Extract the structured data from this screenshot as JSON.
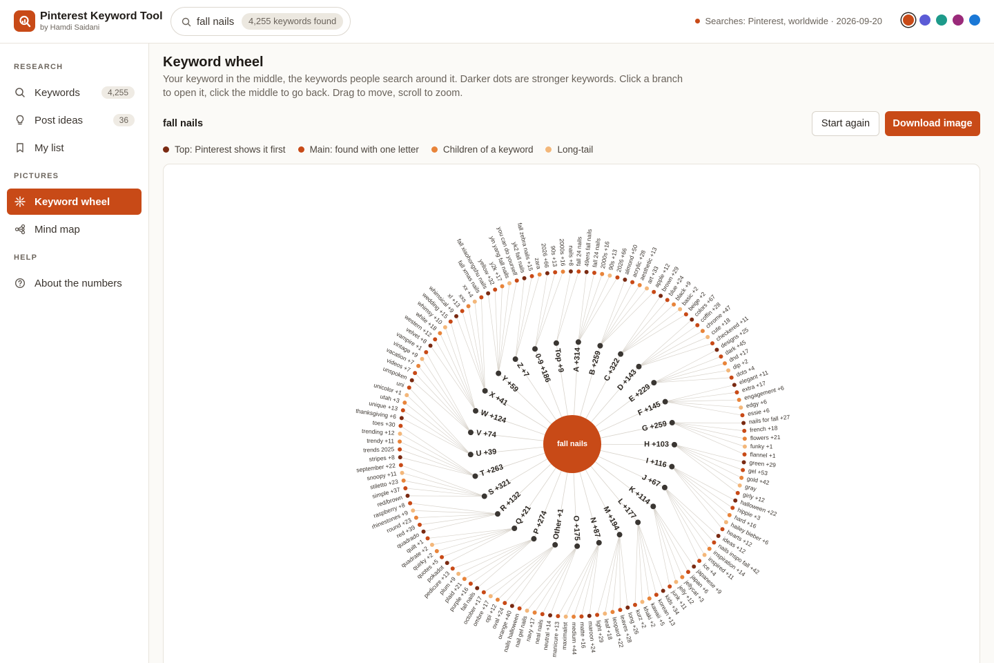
{
  "app": {
    "title": "Pinterest Keyword Tool",
    "byline": "by Hamdi Saidani",
    "brand_color": "#c84a17"
  },
  "search": {
    "query": "fall nails",
    "count_label": "4,255 keywords found",
    "icon": "search-icon"
  },
  "status": {
    "text": "Searches: Pinterest, worldwide · 2026-09-20"
  },
  "theme_swatches": [
    "#c84a17",
    "#5b5bd6",
    "#1d9a8a",
    "#9a2a7a",
    "#1a78d6"
  ],
  "sidebar": {
    "sections": [
      {
        "label": "RESEARCH",
        "items": [
          {
            "label": "Keywords",
            "badge": "4,255",
            "icon": "search-icon"
          },
          {
            "label": "Post ideas",
            "badge": "36",
            "icon": "lightbulb-icon"
          },
          {
            "label": "My list",
            "badge": "",
            "icon": "bookmark-icon"
          }
        ]
      },
      {
        "label": "PICTURES",
        "items": [
          {
            "label": "Keyword wheel",
            "badge": "",
            "icon": "sparkle-icon",
            "active": true
          },
          {
            "label": "Mind map",
            "badge": "",
            "icon": "mindmap-icon"
          }
        ]
      },
      {
        "label": "HELP",
        "items": [
          {
            "label": "About the numbers",
            "badge": "",
            "icon": "help-circle-icon"
          }
        ]
      }
    ]
  },
  "main": {
    "title": "Keyword wheel",
    "description": "Your keyword in the middle, the keywords people search around it. Darker dots are stronger keywords. Click a branch to open it, click the middle to go back. Drag to move, scroll to zoom.",
    "keyword_label": "fall nails",
    "start_again_label": "Start again",
    "download_label": "Download image",
    "legend": [
      {
        "label": "Top: Pinterest shows it first",
        "color": "#7a2a12"
      },
      {
        "label": "Main: found with one letter",
        "color": "#c84a17"
      },
      {
        "label": "Children of a keyword",
        "color": "#e8843a"
      },
      {
        "label": "Long-tail",
        "color": "#f3b77a"
      }
    ]
  },
  "wheel": {
    "center_label": "fall nails",
    "branches": [
      {
        "label": "A +314",
        "leaves": [
          "49ers fall nails",
          "fall 24 nails",
          "2000s +16",
          "90s +13",
          "2026 +66"
        ]
      },
      {
        "label": "B +259",
        "leaves": [
          "almond +50",
          "acrylic +28",
          "aesthetic +13",
          "art +33",
          "apple +12"
        ]
      },
      {
        "label": "C +322",
        "leaves": [
          "brown +29",
          "blue +24",
          "black +9",
          "basic +2",
          "beige +2"
        ]
      },
      {
        "label": "D +143",
        "leaves": [
          "colors +67",
          "coffin +28",
          "chrome +47",
          "cute +18",
          "checkered +11"
        ]
      },
      {
        "label": "E +229",
        "leaves": [
          "designs +25",
          "dark +45",
          "dnd +17",
          "dip +2",
          "dots +4"
        ]
      },
      {
        "label": "F +145",
        "leaves": [
          "elegant +11",
          "extra +17",
          "engagement +6",
          "edgy +6",
          "essie +6"
        ]
      },
      {
        "label": "G +259",
        "leaves": [
          "nails for fall +27",
          "french +18",
          "flowers +21",
          "funky +1",
          "flannel +1"
        ]
      },
      {
        "label": "H +103",
        "leaves": [
          "green +29",
          "gel +53",
          "gold +42",
          "gray",
          "girly +12"
        ]
      },
      {
        "label": "I +116",
        "leaves": [
          "halloween +22",
          "hippie +3",
          "hard +16",
          "hailey bieber +6",
          "hearts +12"
        ]
      },
      {
        "label": "J +67",
        "leaves": [
          "ideas +12",
          "nails inspo fall +42",
          "inspiration +14",
          "inspired +11",
          "ice +4"
        ]
      },
      {
        "label": "K +114",
        "leaves": [
          "japanese +9",
          "japan +6",
          "jellycat +3",
          "jelly +12",
          "junk +11"
        ]
      },
      {
        "label": "L +177",
        "leaves": [
          "kids +34",
          "korean +13",
          "kawaii +5",
          "khaki +2",
          "kurz +2"
        ]
      },
      {
        "label": "M +194",
        "leaves": [
          "long +26",
          "leaves +28",
          "leopard +22",
          "leaf +18",
          "light +29"
        ]
      },
      {
        "label": "N +87",
        "leaves": [
          "maroon +24",
          "matte +16",
          "medium +44",
          "maximalist",
          "manicure +13"
        ]
      },
      {
        "label": "O +175",
        "leaves": [
          "neutral +14",
          "neal nails",
          "navy +17",
          "nail gel nails",
          "nails halloween"
        ]
      },
      {
        "label": "Other +1",
        "leaves": [
          "orange +40",
          "oval +24",
          "opi +12",
          "ombre +17",
          "october +17"
        ]
      },
      {
        "label": "P +274",
        "leaves": [
          "fall nails",
          "purple +16",
          "plaid +21",
          "plum +9",
          "pedicure +13"
        ]
      },
      {
        "label": "Q +21",
        "leaves": [
          "pokadot",
          "quotes +5",
          "quirky +2",
          "quadrate +2",
          "quilt +1"
        ]
      },
      {
        "label": "R +132",
        "leaves": [
          "quadrado",
          "red +39",
          "round +23",
          "rhinestones +9",
          "raspberry +8"
        ]
      },
      {
        "label": "S +321",
        "leaves": [
          "red/brown",
          "simple +37",
          "stiletto +23",
          "snoopy +11",
          "september +22"
        ]
      },
      {
        "label": "T +263",
        "leaves": [
          "stripes +8",
          "trends 2025",
          "trendy +11",
          "trending +12",
          "toes +30"
        ]
      },
      {
        "label": "U +39",
        "leaves": [
          "thanksgiving +6",
          "unique +13",
          "utah +3",
          "unicolor +1",
          "uni"
        ]
      },
      {
        "label": "V +74",
        "leaves": [
          "unspoken",
          "videos +7",
          "vacation +7",
          "vintage +9",
          "vampire +1"
        ]
      },
      {
        "label": "W +124",
        "leaves": [
          "velvet +8",
          "western +12",
          "white +18",
          "whimsy +10",
          "wedding +15"
        ]
      },
      {
        "label": "X +41",
        "leaves": [
          "whimsical +9",
          "xl +13",
          "xxs",
          "xx +4",
          "fall xmas nails"
        ]
      },
      {
        "label": "Y +59",
        "leaves": [
          "fall xiaohongshu nails",
          "yellow +32",
          "y2k +17",
          "yin yang fall nails",
          "you can do yourself"
        ]
      },
      {
        "label": "Z +7",
        "leaves": [
          "yk2 fall nails",
          "fall zebra nails +15",
          "zara"
        ]
      },
      {
        "label": "0-9 +186",
        "leaves": [
          "2026 +66",
          "90s +13",
          "2000s +16"
        ]
      },
      {
        "label": "Top +9",
        "leaves": [
          "nails +8",
          "fall 24 nails"
        ]
      }
    ]
  }
}
